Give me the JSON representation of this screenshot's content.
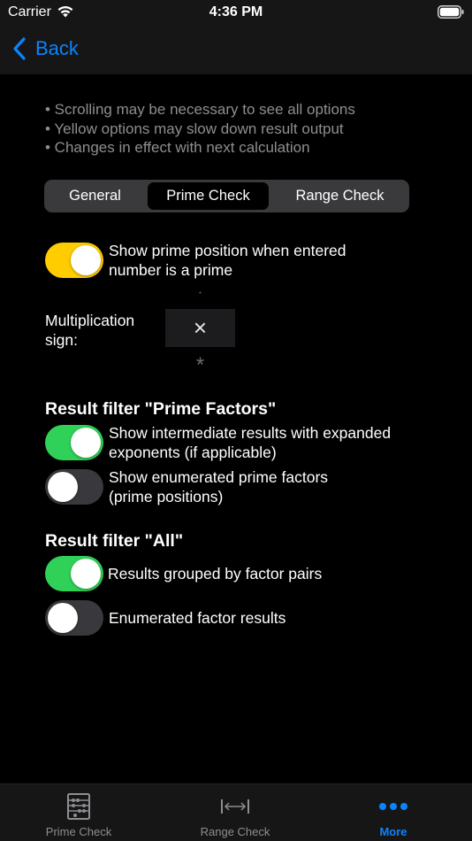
{
  "status_bar": {
    "carrier": "Carrier",
    "time": "4:36 PM",
    "wifi_icon": "wifi-icon",
    "battery_icon": "battery-icon"
  },
  "nav": {
    "back_label": "Back",
    "back_icon": "chevron-left-icon",
    "accent_color": "#0a84ff"
  },
  "hints": [
    "• Scrolling may be necessary to see all options",
    "• Yellow options may slow down result output",
    "• Changes in effect with next calculation"
  ],
  "segments": {
    "items": [
      "General",
      "Prime Check",
      "Range Check"
    ],
    "selected": "Prime Check"
  },
  "prime_position": {
    "label": "Show prime position when entered number is a prime",
    "on": true,
    "color": "#ffcc00"
  },
  "multiplication": {
    "label": "Multiplication sign:",
    "option_above": "·",
    "selected": "×",
    "option_below": "*"
  },
  "filter_prime_factors": {
    "title": "Result filter \"Prime Factors\"",
    "options": [
      {
        "label": "Show intermediate results with expanded exponents (if applicable)",
        "on": true
      },
      {
        "label": "Show enumerated prime factors (prime positions)",
        "on": false
      }
    ]
  },
  "filter_all": {
    "title": "Result filter \"All\"",
    "options": [
      {
        "label": "Results grouped by factor pairs",
        "on": true
      },
      {
        "label": "Enumerated factor results",
        "on": false
      }
    ]
  },
  "colors": {
    "toggle_on": "#30d158",
    "toggle_off": "#39393d"
  },
  "tab_bar": {
    "tabs": [
      {
        "label": "Prime Check",
        "icon": "abacus-icon"
      },
      {
        "label": "Range Check",
        "icon": "range-arrows-icon"
      },
      {
        "label": "More",
        "icon": "more-dots-icon"
      }
    ],
    "selected": "More"
  }
}
